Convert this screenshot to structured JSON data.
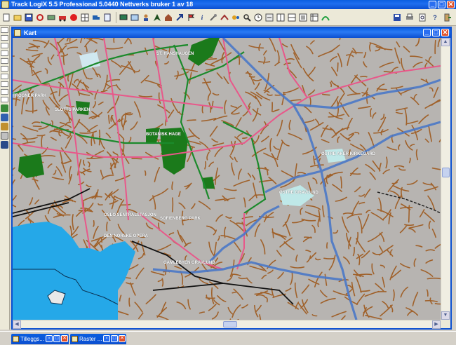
{
  "app": {
    "title": "Track LogiX 5.5 Professional 5.0440 Nettverks bruker 1 av 18",
    "minimize": "_",
    "maximize": "□",
    "close": "✕"
  },
  "map_window": {
    "title": "Kart",
    "minimize": "_",
    "maximize": "□",
    "close": "✕"
  },
  "map_labels": [
    {
      "text": "ST. HANSHAUGEN",
      "id": "sthanshaugen"
    },
    {
      "text": "FROGNER PARK",
      "id": "frogner"
    },
    {
      "text": "SLOTTS PARKEN",
      "id": "slottsparken"
    },
    {
      "text": "BOTANISK HAGE",
      "id": "botanisk"
    },
    {
      "text": "OSLO SENTRALSTASJON",
      "id": "sentralstasjon"
    },
    {
      "text": "DEN NORSKE OPERA",
      "id": "opera"
    },
    {
      "text": "ØSTRE GRAVLUND",
      "id": "ostre"
    },
    {
      "text": "ØSTRE AKER KIRKEGÅRD",
      "id": "aker"
    },
    {
      "text": "SOFIENBERG PARK",
      "id": "sofienberg"
    },
    {
      "text": "GAMLEBYEN GRAVLUND",
      "id": "gamlebyen"
    }
  ],
  "taskbar": {
    "items": [
      {
        "label": "Tilleggs...",
        "id": "tillegg"
      },
      {
        "label": "Raster ...",
        "id": "raster"
      }
    ]
  },
  "colors": {
    "title_blue": "#0b4fd0",
    "water": "#25a8e8",
    "park": "#1b7a1b",
    "street": "#a0612a",
    "main_road": "#e8588a",
    "highway": "#4a78c8"
  }
}
